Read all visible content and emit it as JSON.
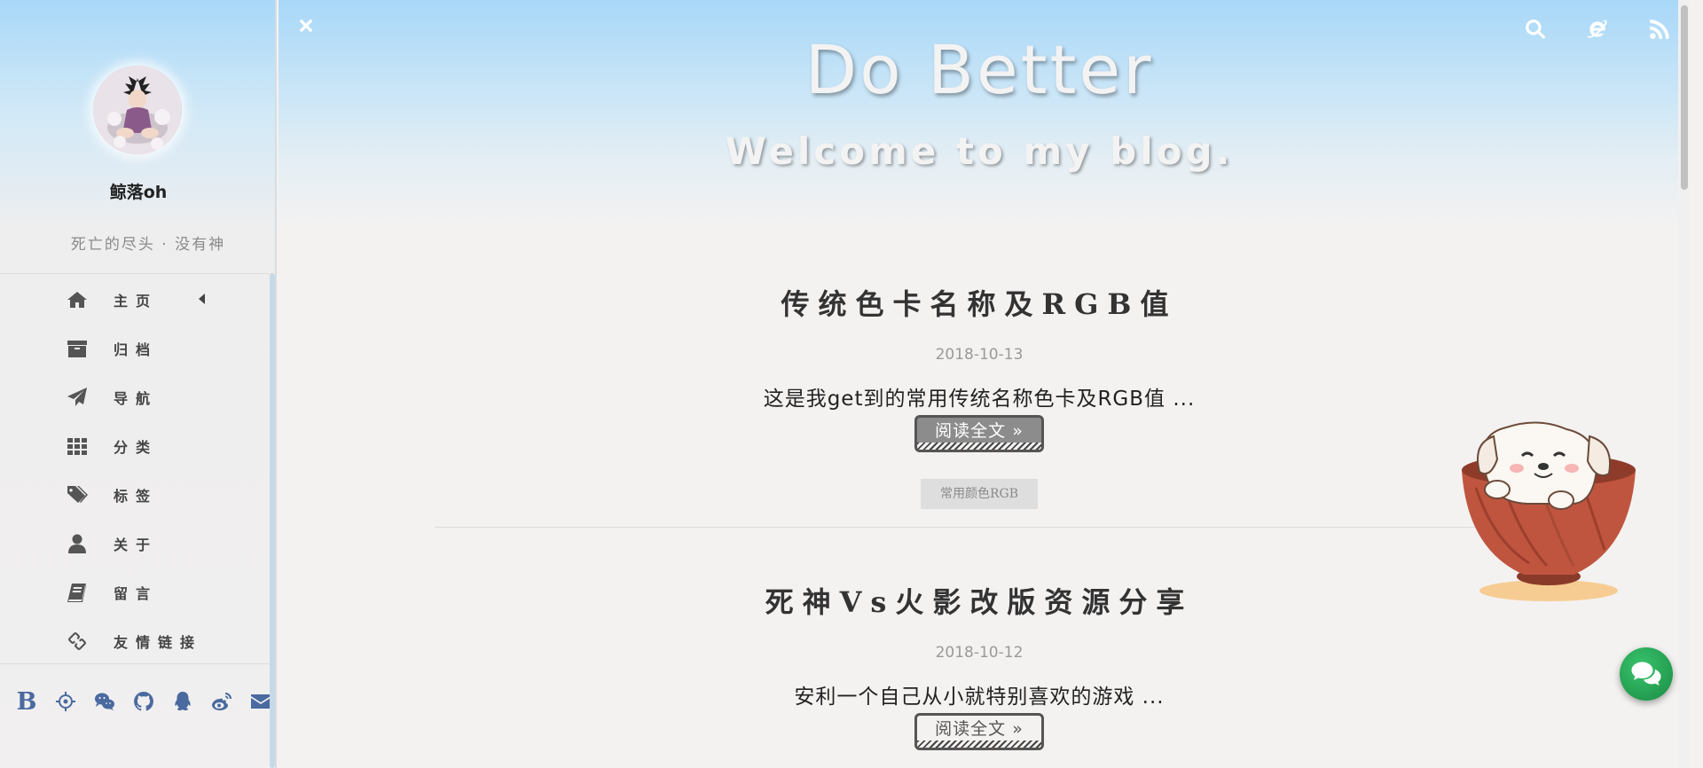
{
  "sidebar": {
    "username": "鲸落oh",
    "motto": "死亡的尽头 · 没有神",
    "nav": [
      {
        "label": "主页",
        "icon": "home-icon"
      },
      {
        "label": "归档",
        "icon": "archive-icon"
      },
      {
        "label": "导航",
        "icon": "paper-plane-icon"
      },
      {
        "label": "分类",
        "icon": "grid-icon"
      },
      {
        "label": "标签",
        "icon": "tags-icon"
      },
      {
        "label": "关于",
        "icon": "user-icon"
      },
      {
        "label": "留言",
        "icon": "book-icon"
      },
      {
        "label": "友情链接",
        "icon": "link-icon"
      }
    ],
    "social": [
      {
        "label": "B",
        "icon": "blog-b-icon"
      },
      {
        "icon": "crosshair-icon"
      },
      {
        "icon": "wechat-icon"
      },
      {
        "icon": "github-icon"
      },
      {
        "icon": "qq-icon"
      },
      {
        "icon": "weibo-icon"
      },
      {
        "icon": "mail-icon"
      }
    ]
  },
  "header": {
    "title": "Do Better",
    "subtitle": "Welcome to my blog.",
    "icons": [
      "search-icon",
      "ie-browser-icon",
      "rss-icon"
    ]
  },
  "posts": [
    {
      "title": "传统色卡名称及RGB值",
      "date": "2018-10-13",
      "excerpt": "这是我get到的常用传统名称色卡及RGB值 ...",
      "read_more": "阅读全文 »",
      "tag": "常用颜色RGB"
    },
    {
      "title": "死神Vs火影改版资源分享",
      "date": "2018-10-12",
      "excerpt": "安利一个自己从小就特别喜欢的游戏 ...",
      "read_more": "阅读全文 »"
    }
  ],
  "colors": {
    "sky": "#a8d8f8",
    "background": "#f4f2f1",
    "social_blue": "#4a6aa0",
    "chat_green": "#22a04f"
  }
}
